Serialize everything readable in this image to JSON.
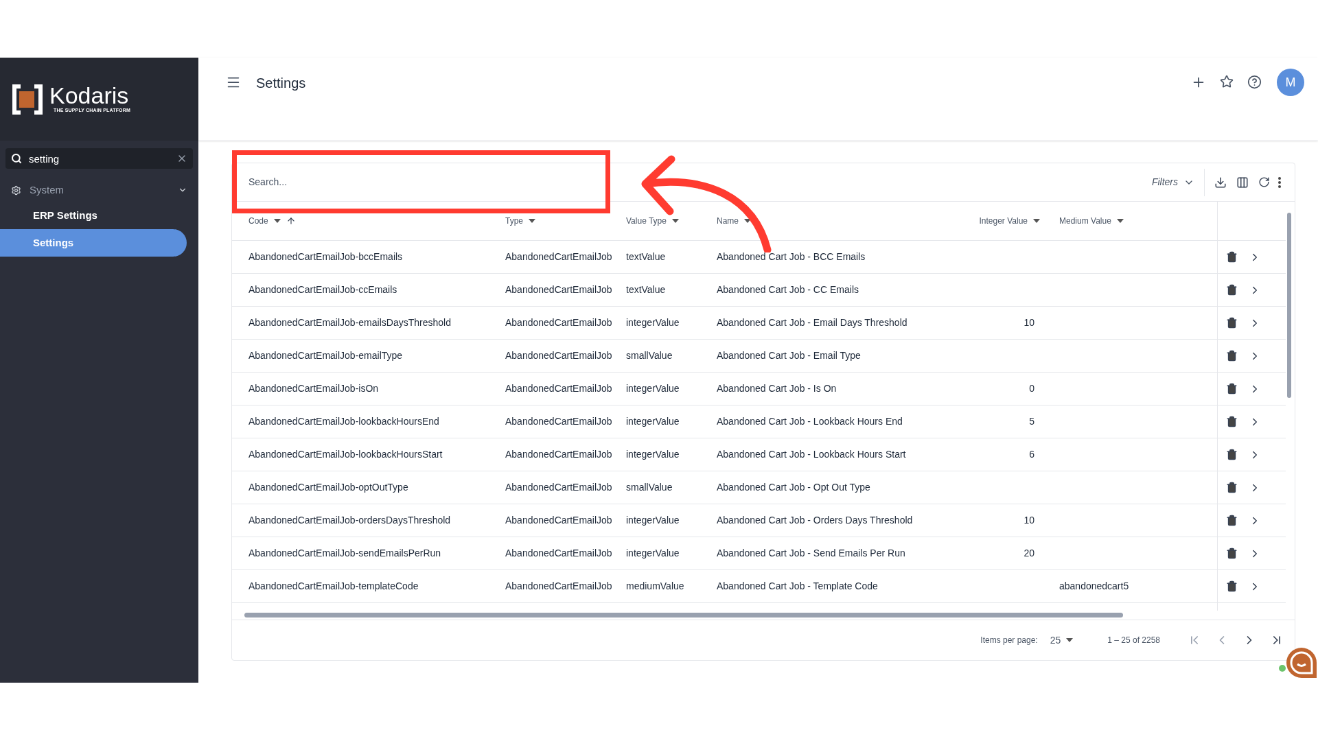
{
  "sidebar": {
    "logo": {
      "name": "Kodaris",
      "tagline": "THE SUPPLY CHAIN PLATFORM"
    },
    "search": {
      "value": "setting"
    },
    "items": [
      {
        "label": "System",
        "expanded": true,
        "selected": false,
        "children": [
          {
            "label": "ERP Settings",
            "selected": false
          },
          {
            "label": "Settings",
            "selected": true
          }
        ]
      }
    ]
  },
  "header": {
    "title": "Settings",
    "avatar": "M"
  },
  "toolbar": {
    "search": {
      "placeholder": "Search..."
    },
    "filters": "Filters"
  },
  "table": {
    "columns": [
      {
        "label": "Code",
        "sorted": true
      },
      {
        "label": "Type",
        "sorted": false
      },
      {
        "label": "Value Type",
        "sorted": false
      },
      {
        "label": "Name",
        "sorted": false
      },
      {
        "label": "Integer Value",
        "sorted": false
      },
      {
        "label": "Medium Value",
        "sorted": false
      }
    ],
    "rows": [
      {
        "code": "AbandonedCartEmailJob-bccEmails",
        "type": "AbandonedCartEmailJob",
        "value_type": "textValue",
        "name": "Abandoned Cart Job - BCC Emails"
      },
      {
        "code": "AbandonedCartEmailJob-ccEmails",
        "type": "AbandonedCartEmailJob",
        "value_type": "textValue",
        "name": "Abandoned Cart Job - CC Emails"
      },
      {
        "code": "AbandonedCartEmailJob-emailsDaysThreshold",
        "type": "AbandonedCartEmailJob",
        "value_type": "integerValue",
        "name": "Abandoned Cart Job - Email Days Threshold",
        "integer_value": "10"
      },
      {
        "code": "AbandonedCartEmailJob-emailType",
        "type": "AbandonedCartEmailJob",
        "value_type": "smallValue",
        "name": "Abandoned Cart Job - Email Type"
      },
      {
        "code": "AbandonedCartEmailJob-isOn",
        "type": "AbandonedCartEmailJob",
        "value_type": "integerValue",
        "name": "Abandoned Cart Job - Is On",
        "integer_value": "0"
      },
      {
        "code": "AbandonedCartEmailJob-lookbackHoursEnd",
        "type": "AbandonedCartEmailJob",
        "value_type": "integerValue",
        "name": "Abandoned Cart Job - Lookback Hours End",
        "integer_value": "5"
      },
      {
        "code": "AbandonedCartEmailJob-lookbackHoursStart",
        "type": "AbandonedCartEmailJob",
        "value_type": "integerValue",
        "name": "Abandoned Cart Job - Lookback Hours Start",
        "integer_value": "6"
      },
      {
        "code": "AbandonedCartEmailJob-optOutType",
        "type": "AbandonedCartEmailJob",
        "value_type": "smallValue",
        "name": "Abandoned Cart Job - Opt Out Type"
      },
      {
        "code": "AbandonedCartEmailJob-ordersDaysThreshold",
        "type": "AbandonedCartEmailJob",
        "value_type": "integerValue",
        "name": "Abandoned Cart Job - Orders Days Threshold",
        "integer_value": "10"
      },
      {
        "code": "AbandonedCartEmailJob-sendEmailsPerRun",
        "type": "AbandonedCartEmailJob",
        "value_type": "integerValue",
        "name": "Abandoned Cart Job - Send Emails Per Run",
        "integer_value": "20"
      },
      {
        "code": "AbandonedCartEmailJob-templateCode",
        "type": "AbandonedCartEmailJob",
        "value_type": "mediumValue",
        "name": "Abandoned Cart Job - Template Code",
        "medium_value": "abandonedcart5"
      }
    ]
  },
  "paginator": {
    "label": "Items per page:",
    "page_size": "25",
    "range": "1 – 25 of 2258"
  }
}
